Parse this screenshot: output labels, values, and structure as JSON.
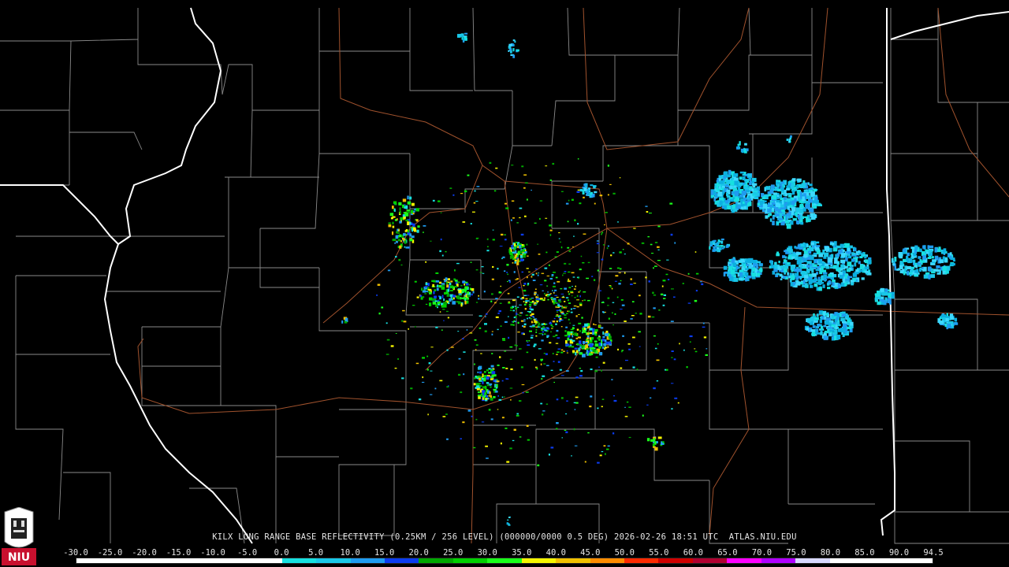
{
  "product_caption": "KILX LONG RANGE BASE REFLECTIVITY (0.25KM / 256 LEVEL) (000000/0000 0.5 DEG) 2026-02-26 18:51 UTC  ATLAS.NIU.EDU",
  "logo_text": "NIU",
  "legend": {
    "ticks": [
      "-30.0",
      "-25.0",
      "-20.0",
      "-15.0",
      "-10.0",
      "-5.0",
      "0.0",
      "5.0",
      "10.0",
      "15.0",
      "20.0",
      "25.0",
      "30.0",
      "35.0",
      "40.0",
      "45.0",
      "50.0",
      "55.0",
      "60.0",
      "65.0",
      "70.0",
      "75.0",
      "80.0",
      "85.0",
      "90.0",
      "94.5"
    ],
    "colors": [
      "#ffffff",
      "#ffffff",
      "#ffffff",
      "#ffffff",
      "#ffffff",
      "#ffffff",
      "#17e0e0",
      "#19c8e8",
      "#1f9cf0",
      "#0b3cf0",
      "#00a800",
      "#00d000",
      "#1aff1a",
      "#f5f500",
      "#f0c000",
      "#ff8c00",
      "#ff2a00",
      "#d00000",
      "#b00030",
      "#ff00ff",
      "#b000ff",
      "#d8d8ff",
      "#ffffff",
      "#ffffff",
      "#ffffff"
    ]
  },
  "map_colors": {
    "background": "#000000",
    "county_lines": "#8a8a8a",
    "state_lines": "#ffffff",
    "highways": "#a0522d"
  }
}
